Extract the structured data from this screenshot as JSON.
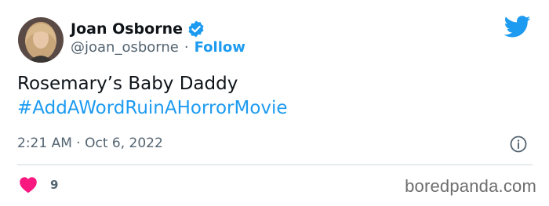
{
  "author": {
    "name": "Joan Osborne",
    "handle": "@joan_osborne",
    "separator": "·",
    "follow_label": "Follow",
    "verified": true
  },
  "tweet": {
    "text": "Rosemary’s Baby Daddy",
    "hashtag": "#AddAWordRuinAHorrorMovie",
    "timestamp": "2:21 AM · Oct 6, 2022",
    "like_count": "9"
  },
  "icons": {
    "brand": "twitter-bird-icon",
    "verified": "verified-badge-icon",
    "info": "info-icon",
    "like": "heart-icon"
  },
  "colors": {
    "accent": "#1d9bf0",
    "like": "#f91880",
    "text": "#0f1419",
    "secondary": "#536471"
  },
  "watermark": "boredpanda.com"
}
